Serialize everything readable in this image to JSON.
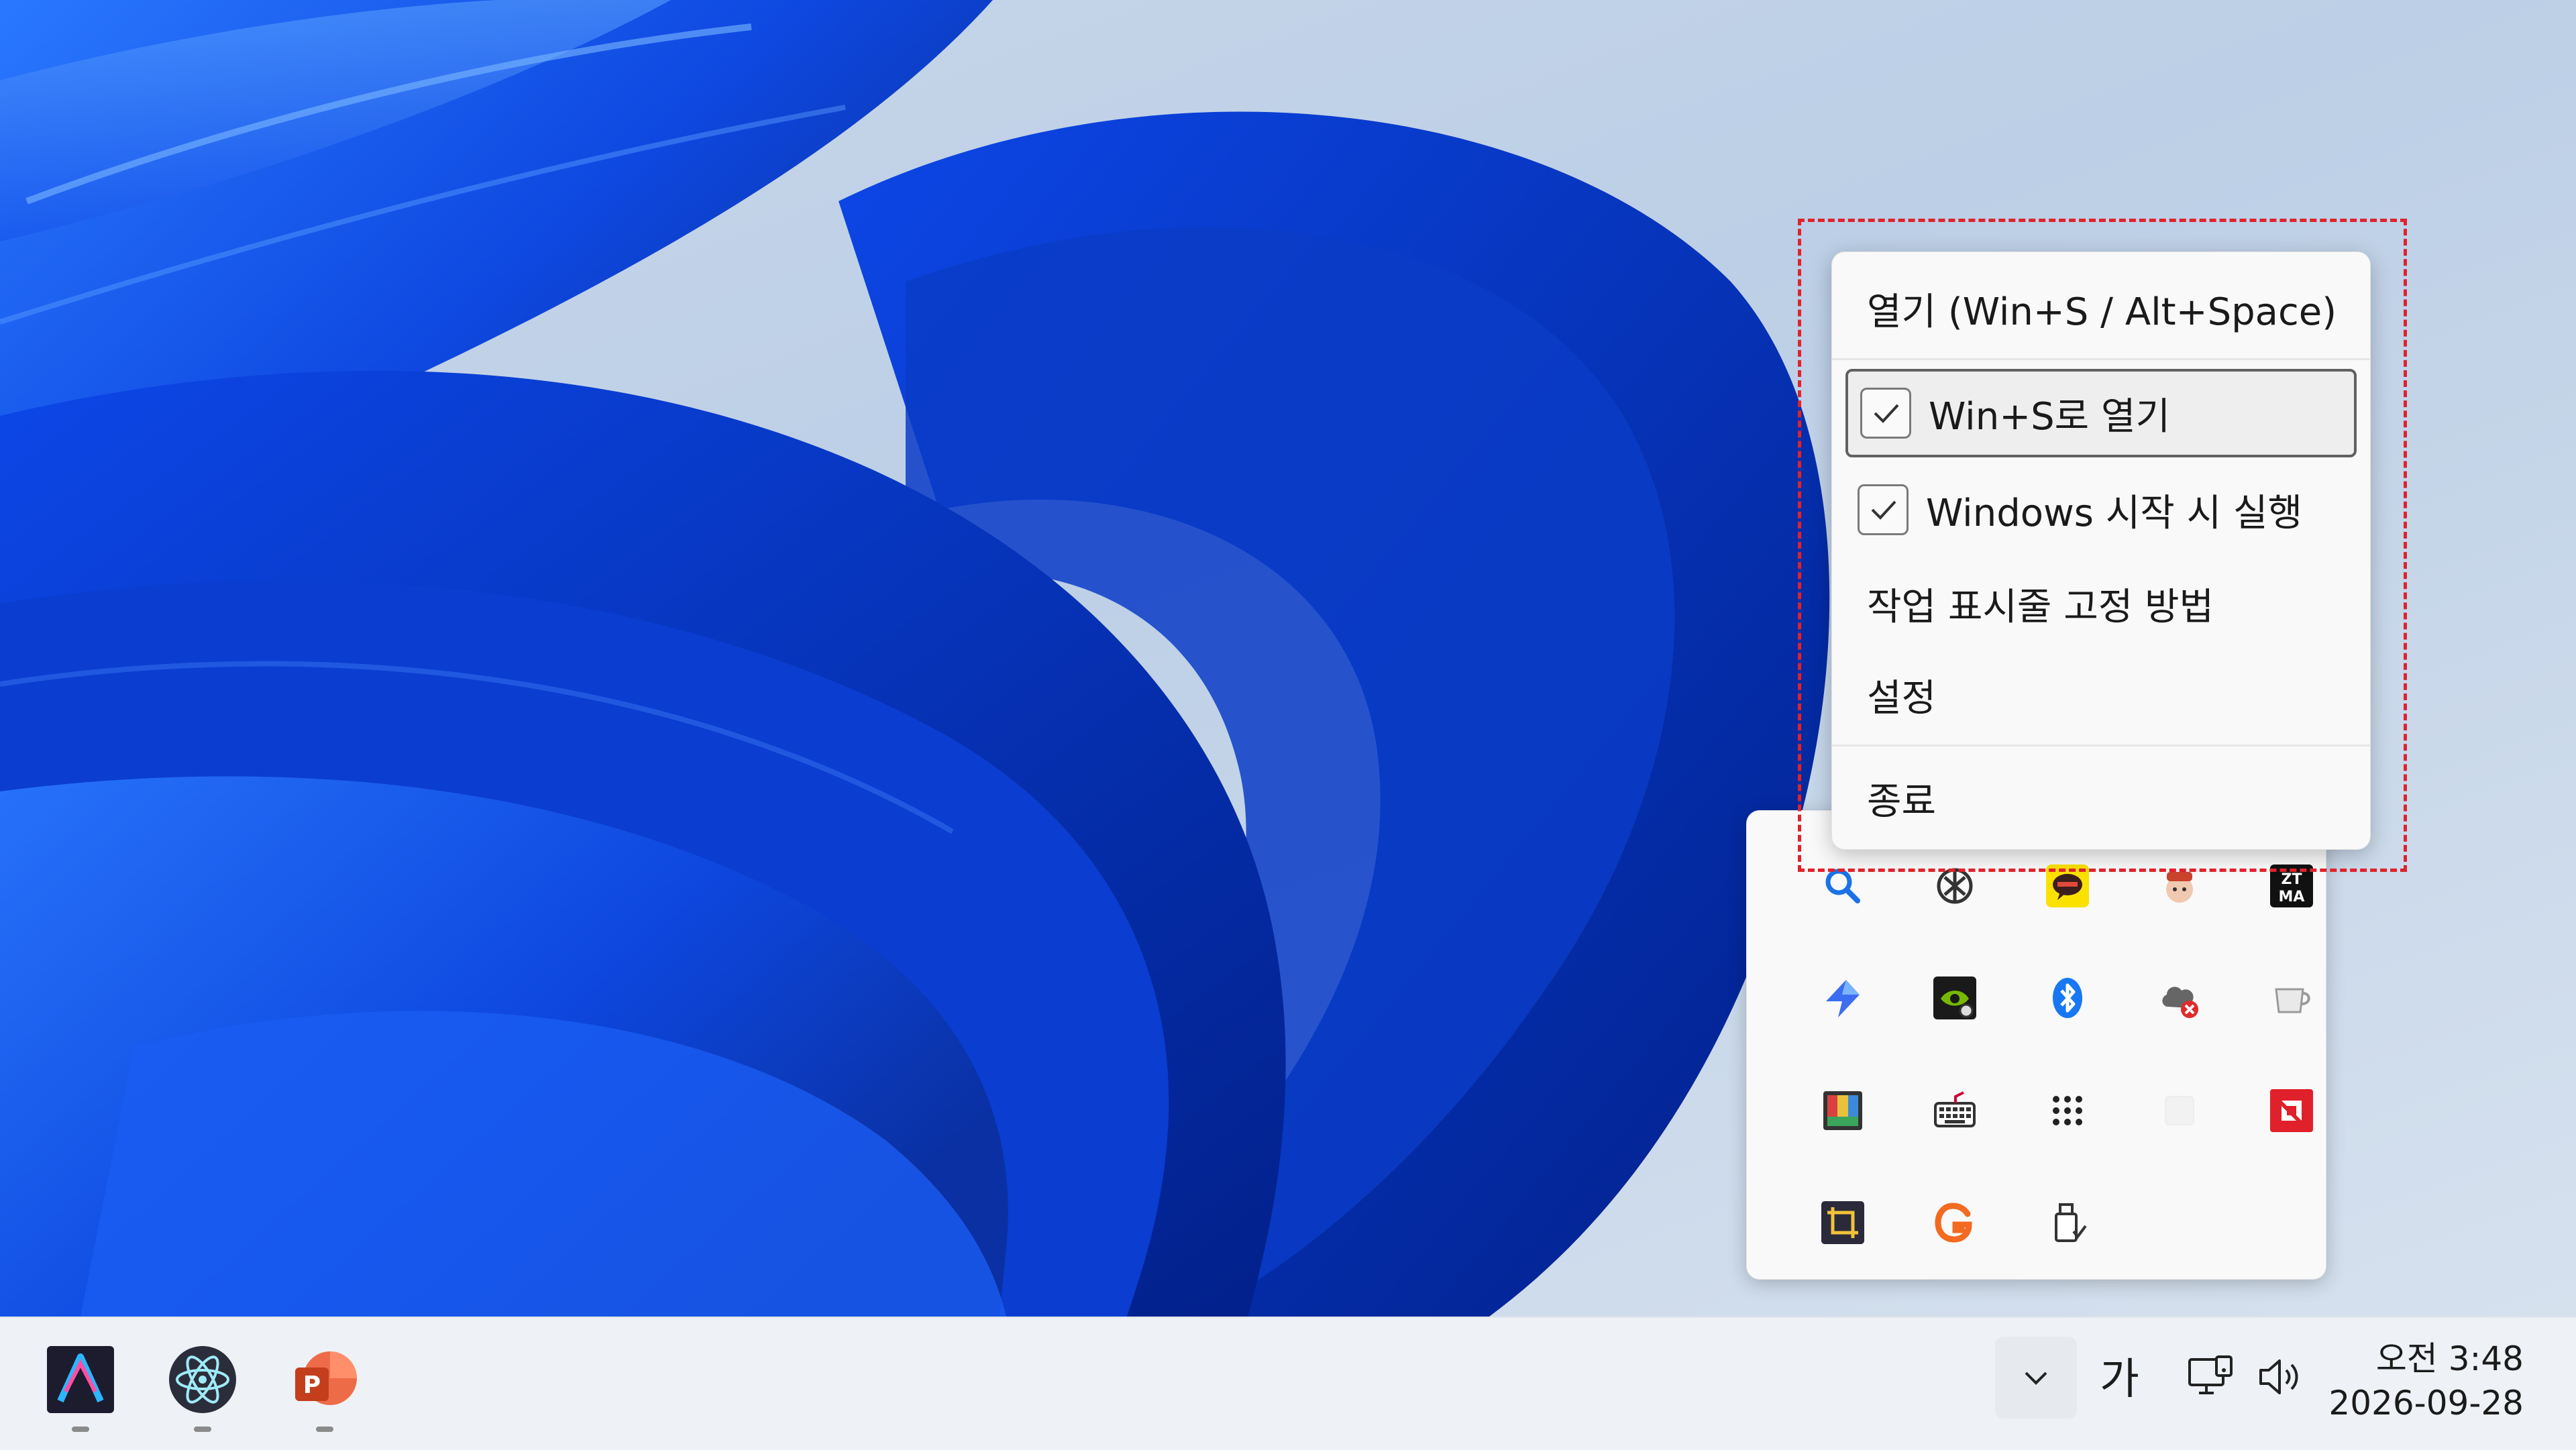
{
  "context_menu": {
    "open": "열기 (Win+S / Alt+Space)",
    "open_with_win_s": "Win+S로 열기",
    "open_with_win_s_checked": true,
    "run_at_startup": "Windows 시작 시 실행",
    "run_at_startup_checked": true,
    "pin_to_taskbar_howto": "작업 표시줄 고정 방법",
    "settings": "설정",
    "exit": "종료"
  },
  "tray_overflow": {
    "icons": [
      "search-app-icon",
      "chatgpt-icon",
      "kakaotalk-icon",
      "mascot-app-icon",
      "ztma-icon",
      "power-automate-icon",
      "nvidia-icon",
      "bluetooth-icon",
      "cloud-error-icon",
      "coffee-cup-icon",
      "color-app-icon",
      "keyboard-icon",
      "dots-grid-icon",
      "blank-icon",
      "amd-icon",
      "crop-tool-icon",
      "grammarly-icon",
      "usb-drive-icon"
    ]
  },
  "taskbar": {
    "apps": [
      "arc-app-icon",
      "electron-app-icon",
      "powerpoint-icon"
    ],
    "ime_label": "가",
    "clock_time": "오전 3:48",
    "clock_date": "2026-09-28"
  },
  "colors": {
    "highlight_dashed": "#e0222b",
    "accent_blue": "#0067c0",
    "wallpaper_blue": "#0a3fd1"
  }
}
